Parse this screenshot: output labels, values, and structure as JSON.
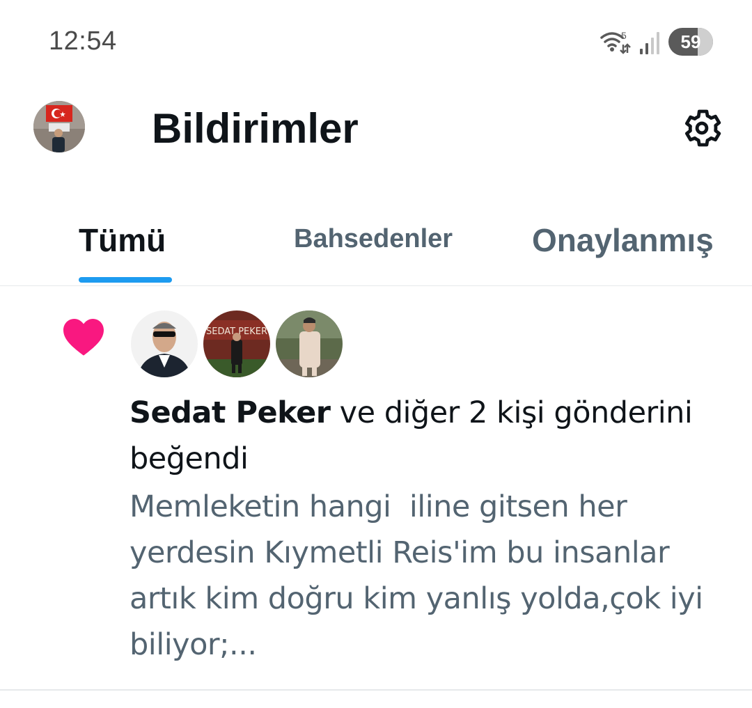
{
  "status_bar": {
    "time": "12:54",
    "wifi_label": "5",
    "battery_level": "59"
  },
  "header": {
    "title": "Bildirimler",
    "avatar": "profile-avatar",
    "settings_icon": "gear-icon"
  },
  "tabs": [
    {
      "label": "Tümü",
      "active": true
    },
    {
      "label": "Bahsedenler",
      "active": false
    },
    {
      "label": "Onaylanmış",
      "active": false
    }
  ],
  "accent_color": "#1d9bf0",
  "like_color": "#f91880",
  "notification": {
    "type_icon": "heart-icon",
    "liker_name": "Sedat Peker",
    "action_text": " ve diğer 2 kişi gönderini beğendi",
    "post_preview": "Memleketin hangi  iline gitsen her yerdesin Kıymetli Reis'im bu insanlar artık kim doğru kim yanlış yolda,çok iyi biliyor;..."
  }
}
